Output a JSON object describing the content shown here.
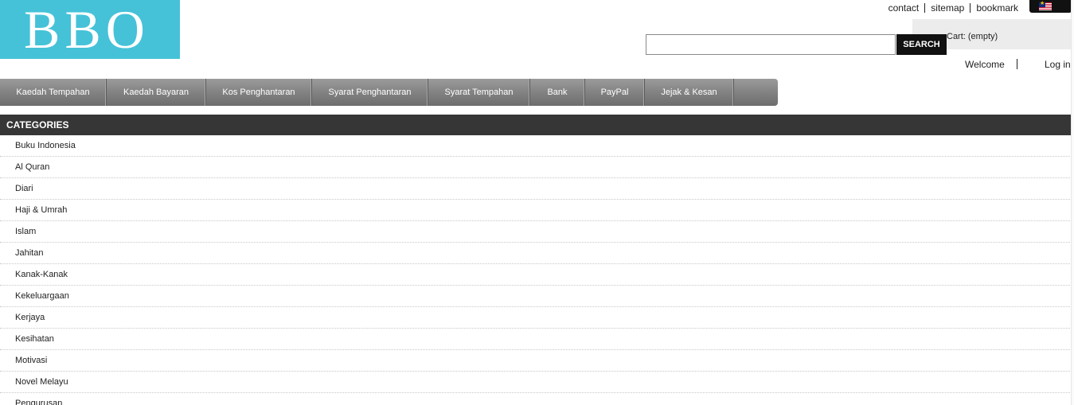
{
  "logo": {
    "text": "BBO",
    "color": "#45c2d8"
  },
  "header_links": [
    "contact",
    "sitemap",
    "bookmark"
  ],
  "language": {
    "icon": "malaysia-flag-icon"
  },
  "cart": {
    "label": "Cart: (empty)"
  },
  "search": {
    "value": "",
    "placeholder": "",
    "button_label": "SEARCH"
  },
  "user": {
    "welcome": "Welcome",
    "login": "Log in"
  },
  "nav": [
    "Kaedah Tempahan",
    "Kaedah Bayaran",
    "Kos Penghantaran",
    "Syarat Penghantaran",
    "Syarat Tempahan",
    "Bank",
    "PayPal",
    "Jejak & Kesan"
  ],
  "categories": {
    "title": "CATEGORIES",
    "items": [
      "Buku Indonesia",
      "Al Quran",
      "Diari",
      "Haji & Umrah",
      "Islam",
      "Jahitan",
      "Kanak-Kanak",
      "Kekeluargaan",
      "Kerjaya",
      "Kesihatan",
      "Motivasi",
      "Novel Melayu",
      "Pengurusan"
    ]
  },
  "colors": {
    "nav_bg": "#858585",
    "category_header_bg": "#363636",
    "search_button_bg": "#111111"
  }
}
